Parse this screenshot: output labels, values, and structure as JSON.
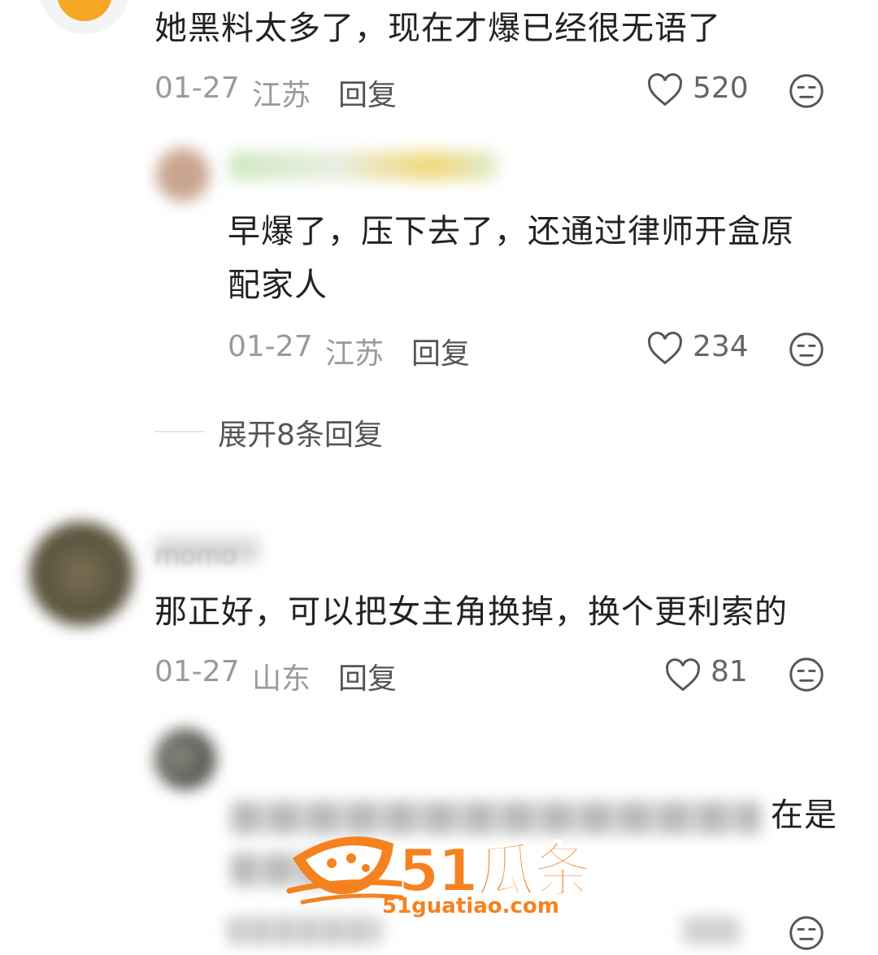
{
  "comments": [
    {
      "text": "她黑料太多了，现在才爆已经很无语了",
      "date": "01-27",
      "location": "江苏",
      "reply_label": "回复",
      "likes": "520",
      "reply": {
        "text_line1": "早爆了，压下去了，还通过律师开盒原",
        "text_line2": "配家人",
        "date": "01-27",
        "location": "江苏",
        "reply_label": "回复",
        "likes": "234"
      },
      "expand_label": "展开8条回复"
    },
    {
      "username": "momo",
      "text": "那正好，可以把女主角换掉，换个更利索的",
      "date": "01-27",
      "location": "山东",
      "reply_label": "回复",
      "likes": "81",
      "reply": {
        "visible_tail": "在是"
      }
    }
  ],
  "watermark": {
    "brand": "51瓜条",
    "url": "51guatiao.com",
    "color": "#f5821f"
  },
  "icons": [
    "heart-icon",
    "unamused-face-icon"
  ]
}
